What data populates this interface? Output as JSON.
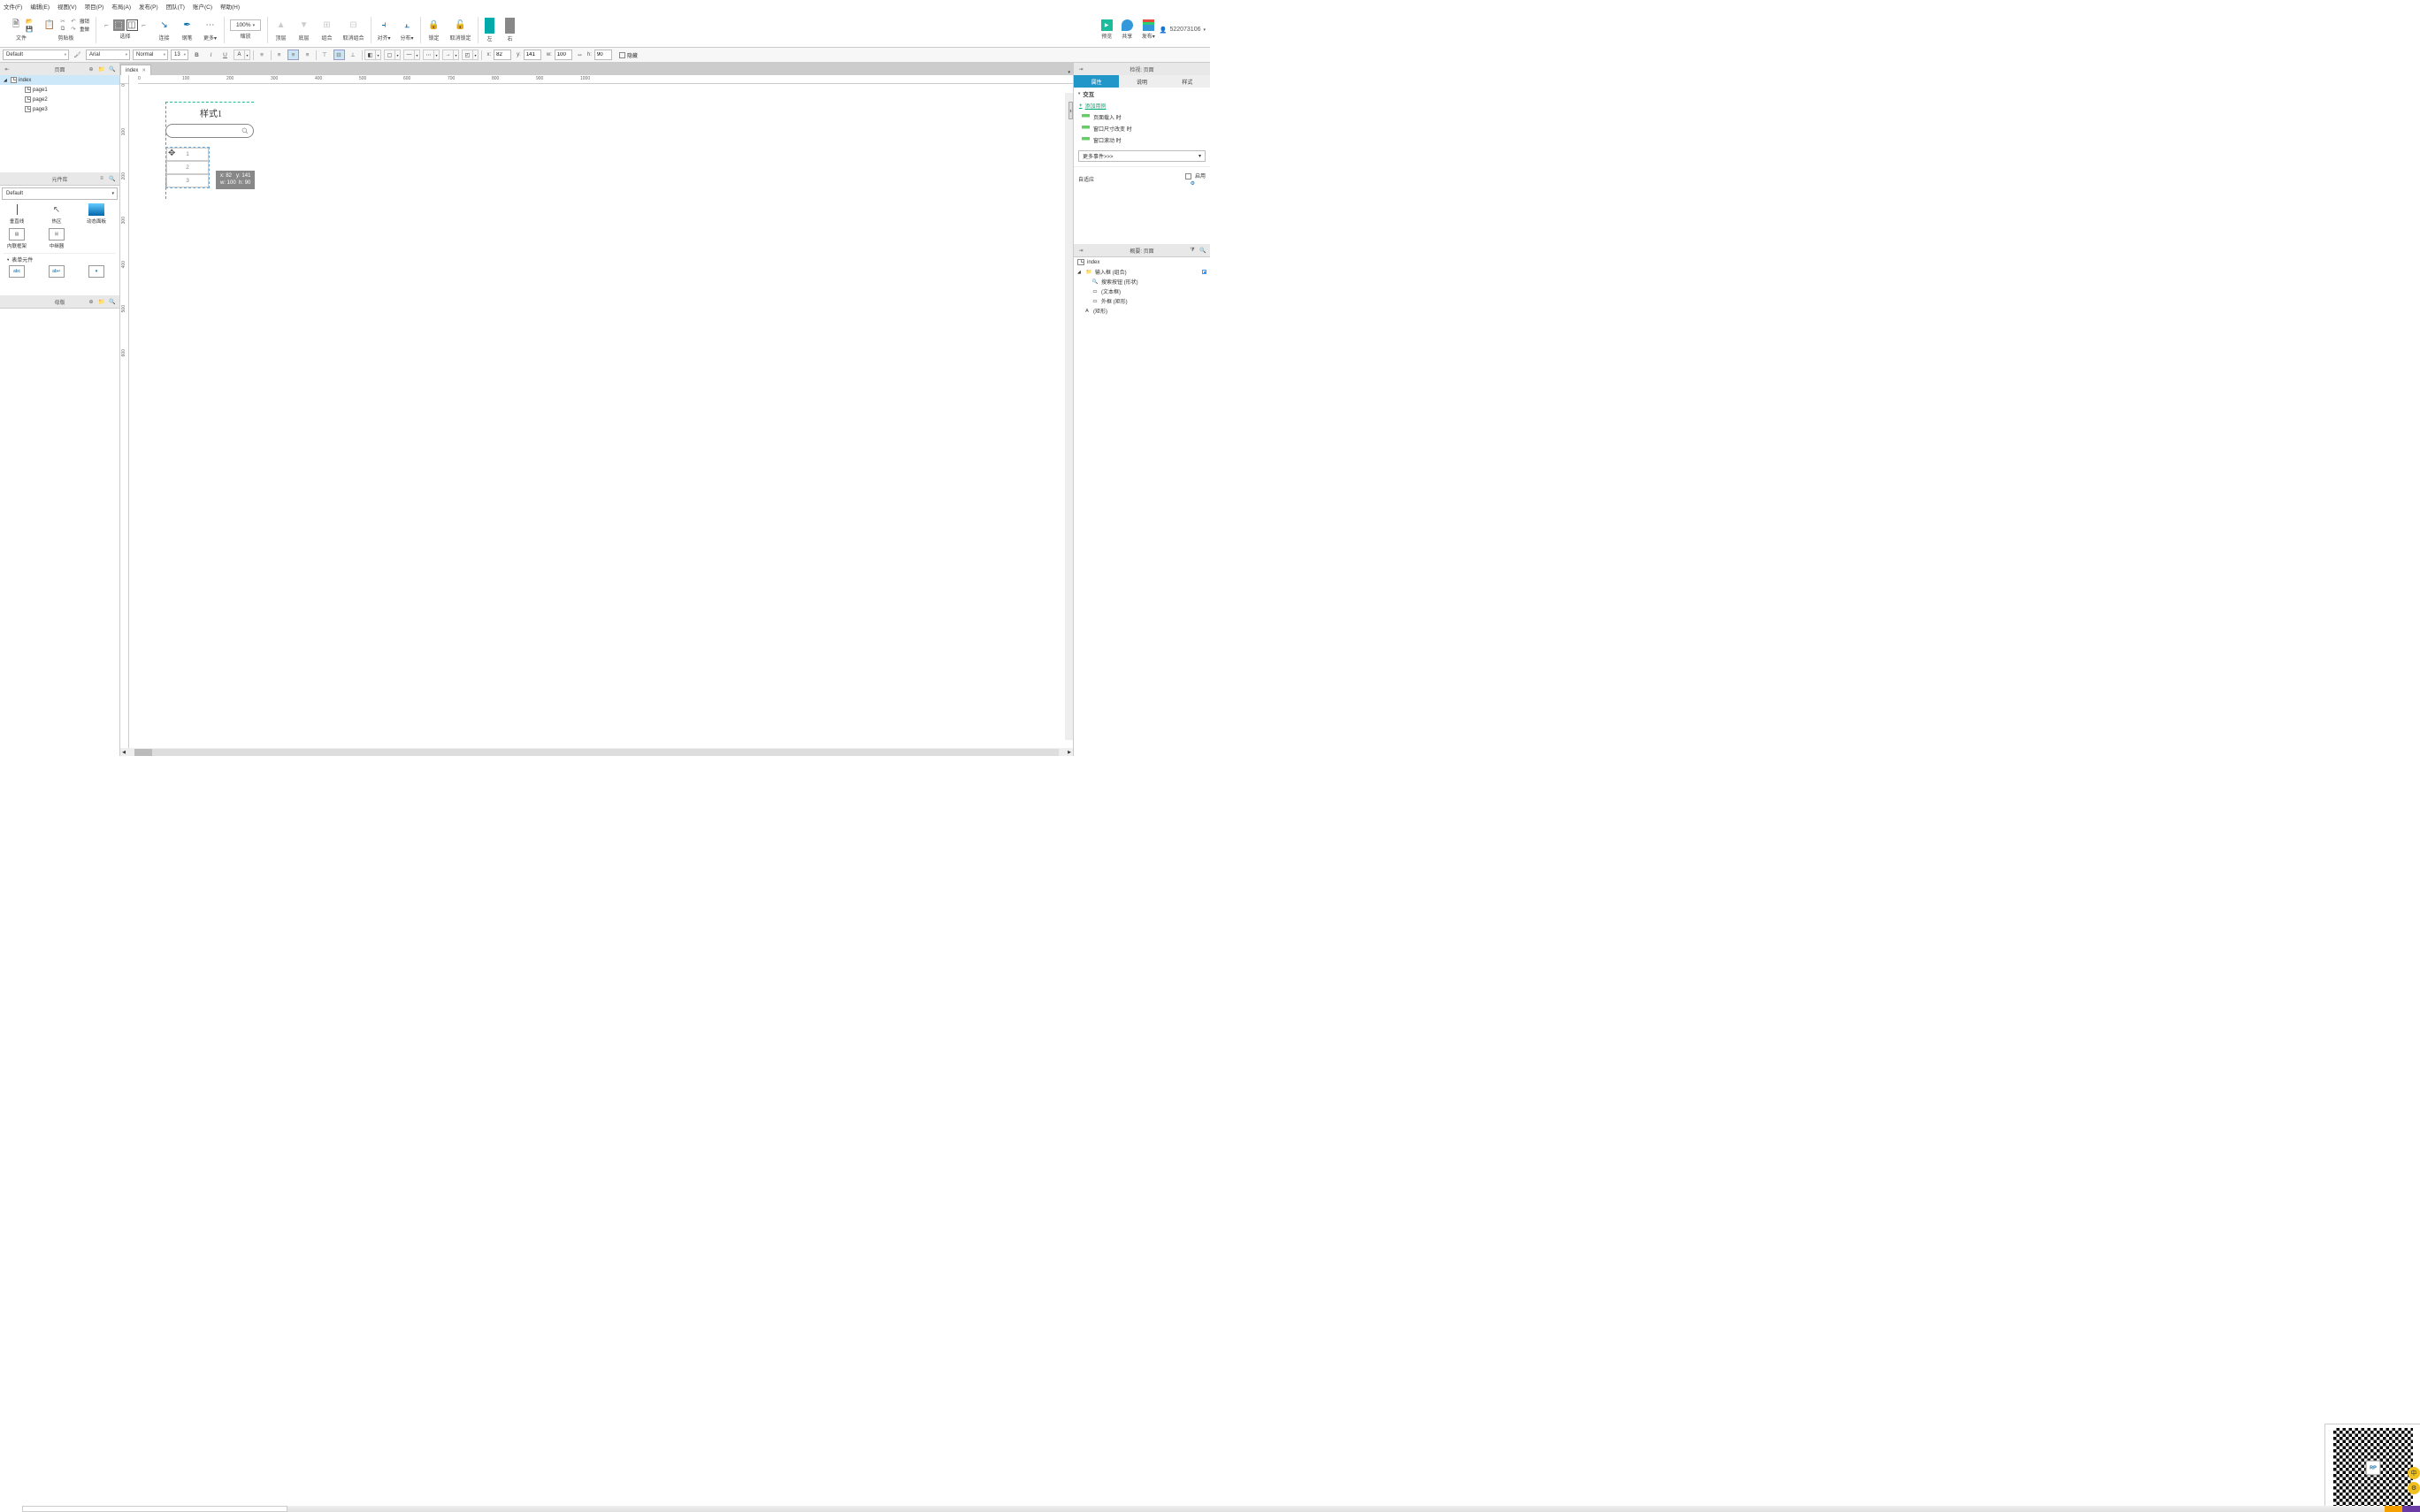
{
  "menu": [
    "文件(F)",
    "编辑(E)",
    "视图(V)",
    "项目(P)",
    "布局(A)",
    "发布(P)",
    "团队(T)",
    "账户(C)",
    "帮助(H)"
  ],
  "toolbar": {
    "file": "文件",
    "clipboard": "剪贴板",
    "undo": "撤销",
    "redo": "重做",
    "select": "选择",
    "connect": "连接",
    "pen": "钢笔",
    "more": "更多▾",
    "zoom": "100%",
    "zoom_label": "缩放",
    "front": "顶层",
    "back": "底层",
    "group": "组合",
    "ungroup": "取消组合",
    "align": "对齐▾",
    "distribute": "分布▾",
    "lock": "锁定",
    "unlock": "取消锁定",
    "left": "左",
    "right": "右",
    "preview": "预览",
    "share": "共享",
    "publish": "发布▾",
    "account": "522073106"
  },
  "formatbar": {
    "style": "Default",
    "font": "Arial",
    "weight": "Normal",
    "size": "13",
    "x_label": "x:",
    "x": "82",
    "y_label": "y:",
    "y": "141",
    "w_label": "w:",
    "w": "100",
    "h_label": "h:",
    "h": "90",
    "hide": "隐藏"
  },
  "pages_panel": {
    "title": "页面",
    "root": "index",
    "children": [
      "page1",
      "page2",
      "page3"
    ]
  },
  "widgets_panel": {
    "title": "元件库",
    "default": "Default",
    "items_row1": [
      "垂直线",
      "热区",
      "动态面板"
    ],
    "items_row2": [
      "内联框架",
      "中继器"
    ],
    "section": "表单元件"
  },
  "masters_panel": {
    "title": "母版"
  },
  "canvas": {
    "tab": "index",
    "ruler_h": [
      "0",
      "100",
      "200",
      "300",
      "400",
      "500",
      "600",
      "700",
      "800",
      "900",
      "1000"
    ],
    "ruler_v": [
      "0",
      "100",
      "200",
      "300",
      "400",
      "500",
      "600"
    ],
    "title_text": "样式1",
    "repeater_rows": [
      "1",
      "2",
      "3"
    ],
    "tooltip": {
      "x_label": "x:",
      "x": "82",
      "y_label": "y:",
      "y": "141",
      "w_label": "w:",
      "w": "100",
      "h_label": "h:",
      "h": "90"
    }
  },
  "inspector": {
    "header": "检视: 页面",
    "tabs": [
      "属性",
      "说明",
      "样式"
    ],
    "interact": "交互",
    "add_case": "添加用例",
    "events": [
      "页面载入 时",
      "窗口尺寸改变 时",
      "窗口滚动 时"
    ],
    "more": "更多事件>>>",
    "adaptive": "自适应",
    "enable": "启用"
  },
  "outline": {
    "header": "概要: 页面",
    "root": "index",
    "group": "输入框 (组合)",
    "items": [
      "搜索按钮 (形状)",
      "(文本框)",
      "外框 (矩形)"
    ],
    "shape": "(矩形)"
  },
  "qr_label": "RP"
}
